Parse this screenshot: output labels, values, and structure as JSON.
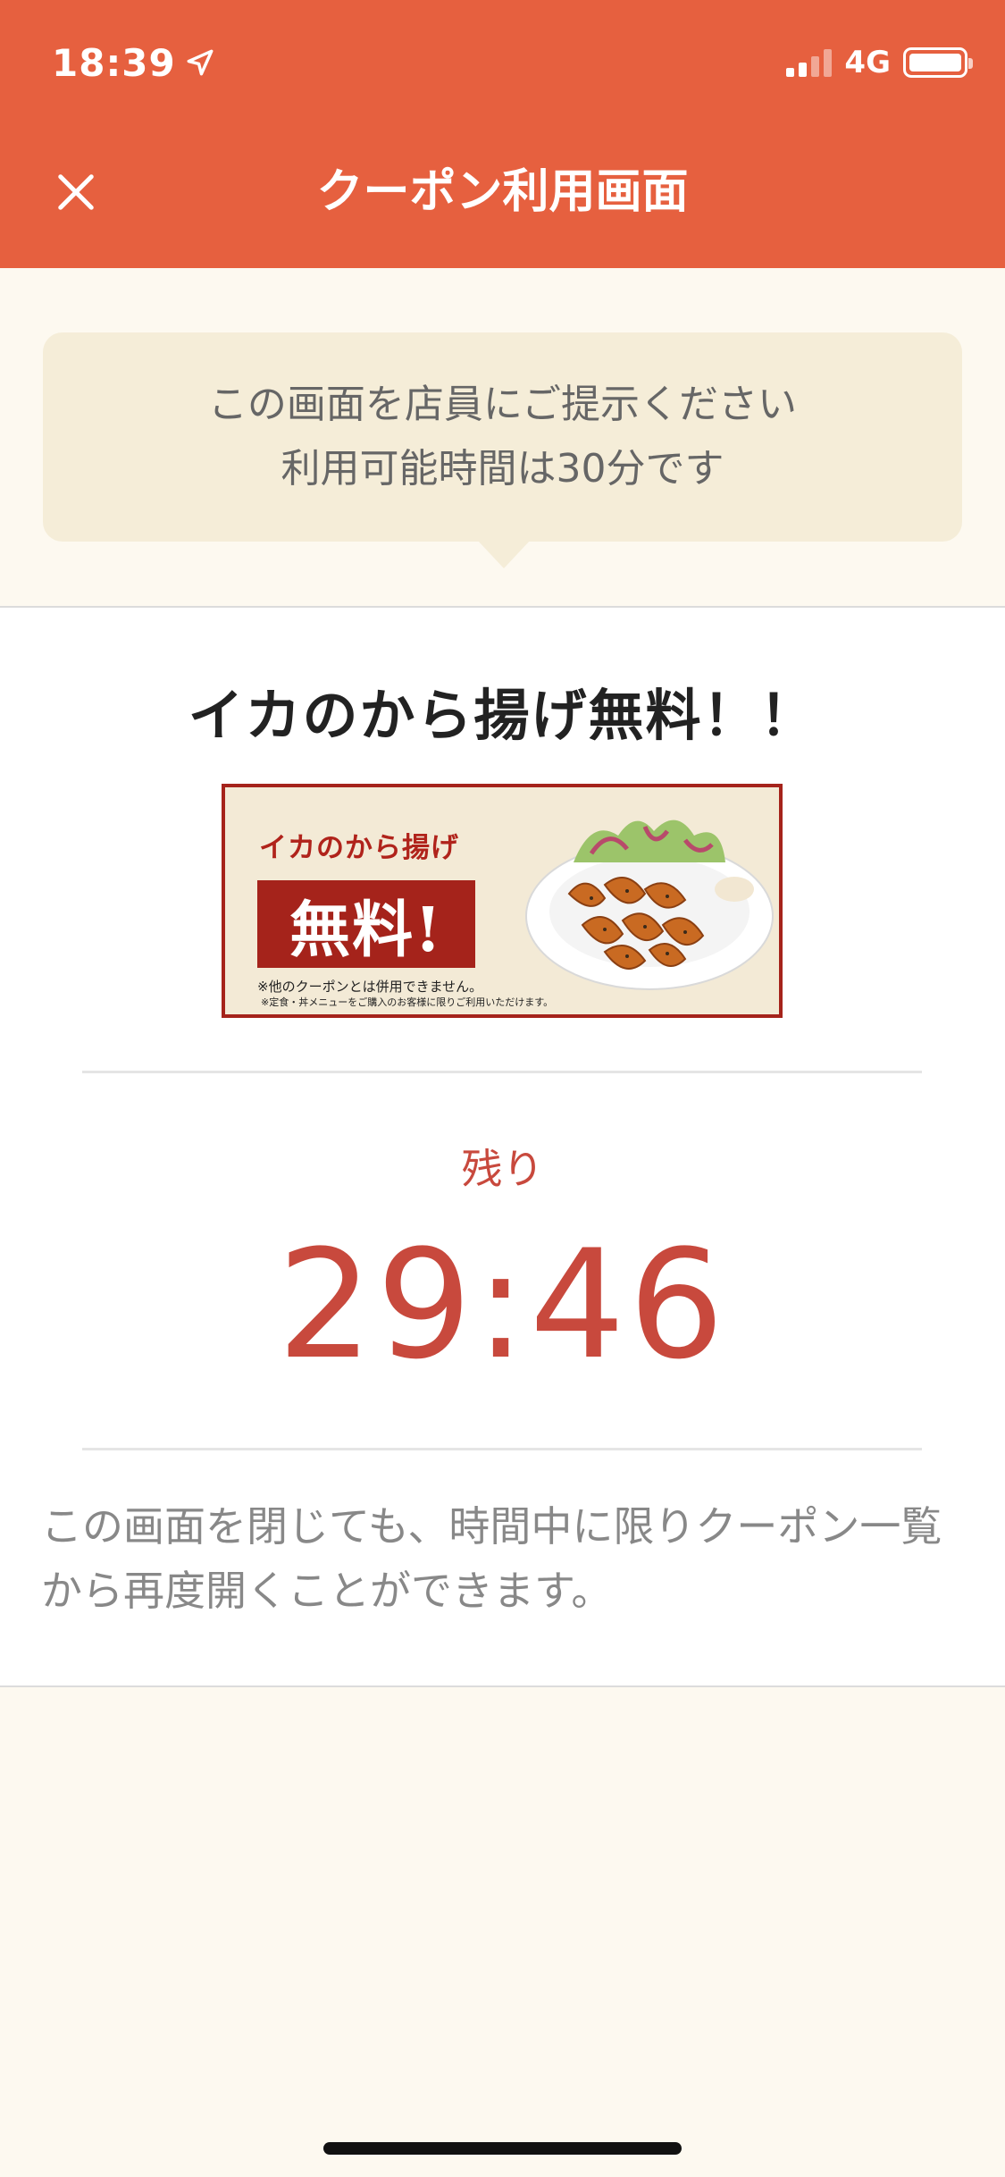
{
  "status_bar": {
    "time": "18:39",
    "network": "4G",
    "location_icon": "location-arrow-icon",
    "signal_icon": "cellular-signal-icon",
    "battery_icon": "battery-full-icon"
  },
  "nav": {
    "title": "クーポン利用画面",
    "close_icon": "close-icon"
  },
  "notice": {
    "line1": "この画面を店員にご提示ください",
    "line2": "利用可能時間は30分です"
  },
  "coupon": {
    "title": "イカのから揚げ無料！！",
    "banner": {
      "subtitle": "イカのから揚げ",
      "headline": "無料!",
      "note1": "※他のクーポンとは併用できません。",
      "note2": "※定食・丼メニューをご購入のお客様に限りご利用いただけます。"
    }
  },
  "timer": {
    "label": "残り",
    "value": "29:46"
  },
  "footer_note": "この画面を閉じても、時間中に限りクーポン一覧から再度開くことができます。",
  "colors": {
    "header": "#e6603f",
    "accent": "#c8493d",
    "notice_bg": "#f5edd8",
    "page_bg": "#fdf9f0"
  }
}
